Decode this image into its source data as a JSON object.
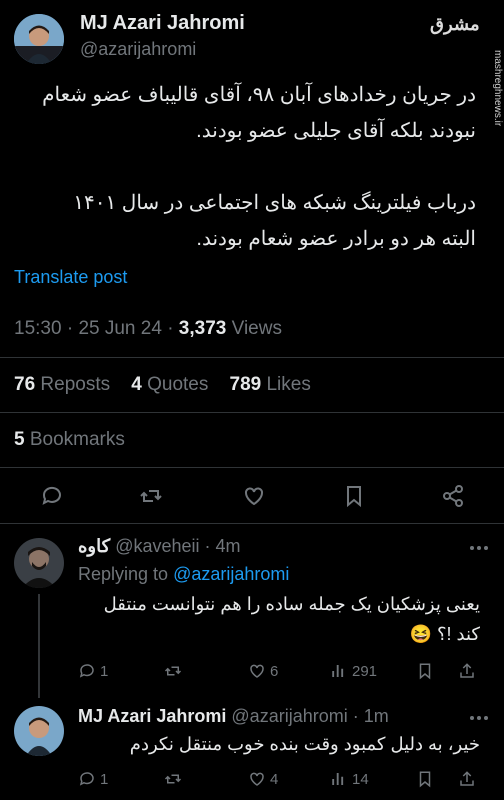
{
  "watermark": "مشرق",
  "watermark_side": "mashreghnews.ir",
  "main_post": {
    "name": "MJ Azari Jahromi",
    "handle": "@azarijahromi",
    "text_lines": [
      "در جریان رخدادهای آبان ۹۸، آقای قالیباف عضو شعام",
      "نبودند بلکه آقای جلیلی عضو بودند.",
      "درباب فیلترینگ شبکه های اجتماعی در سال ۱۴۰۱",
      "البته هر دو برادر عضو شعام بودند."
    ],
    "translate": "Translate post",
    "time": "15:30",
    "date": "25 Jun 24",
    "views_count": "3,373",
    "views_label": "Views",
    "reposts_count": "76",
    "reposts_label": "Reposts",
    "quotes_count": "4",
    "quotes_label": "Quotes",
    "likes_count": "789",
    "likes_label": "Likes",
    "bookmarks_count": "5",
    "bookmarks_label": "Bookmarks"
  },
  "reply1": {
    "name": "کاوه",
    "handle": "@kaveheii",
    "time": "· 4m",
    "replying_label": "Replying to",
    "replying_handle": "@azarijahromi",
    "text_lines": [
      "یعنی پزشکیان یک جمله ساده را هم نتوانست منتقل",
      "کند !؟ 😆"
    ],
    "replies": "1",
    "likes": "6",
    "views": "291"
  },
  "reply2": {
    "name": "MJ Azari Jahromi",
    "handle": "@azarijahromi",
    "time": "· 1m",
    "text": "خیر، به دلیل کمبود وقت بنده خوب منتقل نکردم",
    "replies": "1",
    "likes": "4",
    "views": "14"
  },
  "colors": {
    "accent": "#1d9bf0",
    "muted": "#71767b",
    "text": "#e7e9ea"
  }
}
